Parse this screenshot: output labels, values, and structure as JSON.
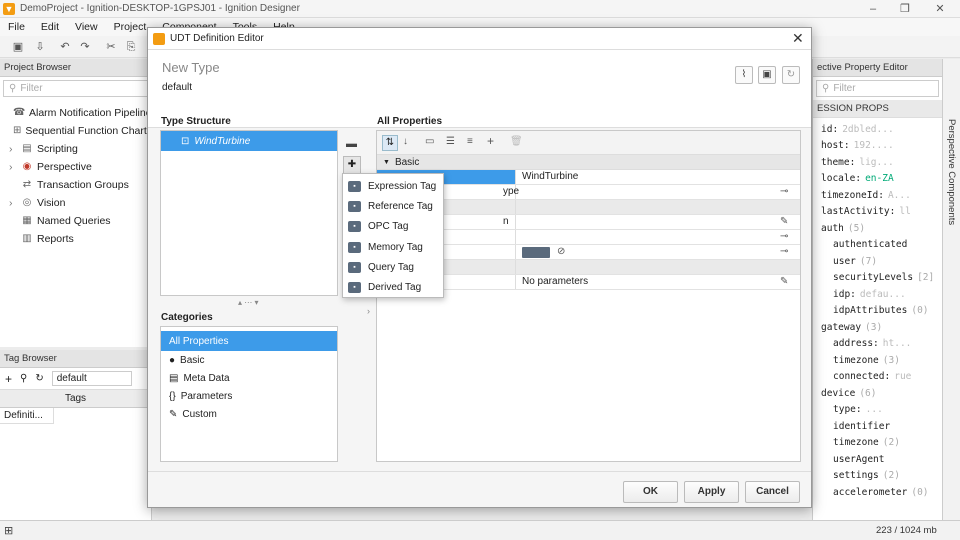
{
  "window": {
    "title": "DemoProject - Ignition-DESKTOP-1GPSJ01 - Ignition Designer"
  },
  "menu": [
    "File",
    "Edit",
    "View",
    "Project",
    "Component",
    "Tools",
    "Help"
  ],
  "project_browser": {
    "title": "Project Browser",
    "filter_placeholder": "Filter",
    "items": [
      {
        "label": "Alarm Notification Pipelines",
        "icon": "alarm-icon"
      },
      {
        "label": "Sequential Function Charts",
        "icon": "sfc-icon"
      },
      {
        "label": "Scripting",
        "icon": "script-icon"
      },
      {
        "label": "Perspective",
        "icon": "perspective-icon"
      },
      {
        "label": "Transaction Groups",
        "icon": "transaction-icon"
      },
      {
        "label": "Vision",
        "icon": "vision-icon"
      },
      {
        "label": "Named Queries",
        "icon": "query-icon"
      },
      {
        "label": "Reports",
        "icon": "report-icon"
      }
    ]
  },
  "tag_browser": {
    "title": "Tag Browser",
    "provider": "default",
    "tab": "Tags",
    "column": "Definiti..."
  },
  "property_editor": {
    "title": "ective Property Editor",
    "filter_placeholder": "Filter",
    "section": "ESSION PROPS",
    "side_tab": "Perspective Components",
    "rows": [
      {
        "key": "id",
        "val": "2dbled...",
        "count": ""
      },
      {
        "key": "host",
        "val": "192....",
        "count": ""
      },
      {
        "key": "theme",
        "val": "lig...",
        "count": ""
      },
      {
        "key": "locale",
        "val": "en-ZA",
        "count": ""
      },
      {
        "key": "timezoneId",
        "val": "A...",
        "count": ""
      },
      {
        "key": "lastActivity",
        "val": "ll",
        "count": ""
      },
      {
        "key": "auth",
        "val": "",
        "count": "(5)"
      },
      {
        "key": "authenticated",
        "val": "",
        "count": ""
      },
      {
        "key": "user",
        "val": "",
        "count": "(7)"
      },
      {
        "key": "securityLevels",
        "val": "",
        "count": "[2]"
      },
      {
        "key": "idp",
        "val": "defau...",
        "count": ""
      },
      {
        "key": "idpAttributes",
        "val": "",
        "count": "(0)"
      },
      {
        "key": "gateway",
        "val": "",
        "count": "(3)"
      },
      {
        "key": "address",
        "val": "ht...",
        "count": ""
      },
      {
        "key": "timezone",
        "val": "",
        "count": "(3)"
      },
      {
        "key": "connected",
        "val": "rue",
        "count": ""
      },
      {
        "key": "device",
        "val": "",
        "count": "(6)"
      },
      {
        "key": "type",
        "val": "...",
        "count": ""
      },
      {
        "key": "identifier",
        "val": "",
        "count": ""
      },
      {
        "key": "timezone",
        "val": "",
        "count": "(2)"
      },
      {
        "key": "userAgent",
        "val": "",
        "count": ""
      },
      {
        "key": "settings",
        "val": "",
        "count": "(2)"
      },
      {
        "key": "accelerometer",
        "val": "",
        "count": "(0)"
      }
    ]
  },
  "dialog": {
    "title": "UDT Definition Editor",
    "type_name": "New Type",
    "provider": "default",
    "type_structure_label": "Type Structure",
    "tree_item": "WindTurbine",
    "all_properties_label": "All Properties",
    "categories_label": "Categories",
    "categories": [
      {
        "label": "All Properties",
        "icon": ""
      },
      {
        "label": "Basic",
        "icon": "info-icon"
      },
      {
        "label": "Meta Data",
        "icon": "metadata-icon"
      },
      {
        "label": "Parameters",
        "icon": "parameters-icon"
      },
      {
        "label": "Custom",
        "icon": "wrench-icon"
      }
    ],
    "group_basic": "Basic",
    "properties": [
      {
        "name": "",
        "value": "WindTurbine"
      },
      {
        "name": "ype",
        "value": ""
      },
      {
        "name": "",
        "value": ""
      },
      {
        "name": "n",
        "value": ""
      },
      {
        "name": "",
        "value": ""
      },
      {
        "name": "",
        "value": ""
      },
      {
        "name": "",
        "value": ""
      },
      {
        "name": "",
        "value": "No parameters"
      }
    ],
    "popup_items": [
      "Expression Tag",
      "Reference Tag",
      "OPC Tag",
      "Memory Tag",
      "Query Tag",
      "Derived Tag"
    ],
    "buttons": {
      "ok": "OK",
      "apply": "Apply",
      "cancel": "Cancel"
    }
  },
  "status": {
    "memory": "223 / 1024 mb"
  }
}
